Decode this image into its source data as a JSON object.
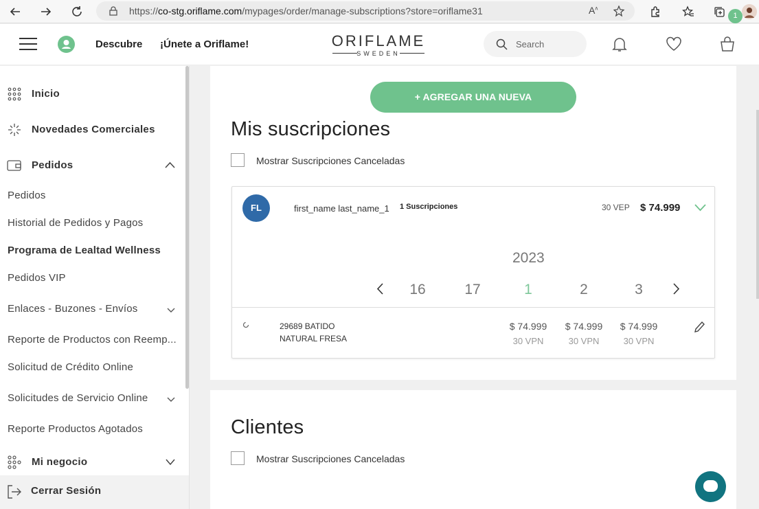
{
  "browser": {
    "url_prefix": "https://",
    "url_domain": "co-stg.oriflame.com",
    "url_path": "/mypages/order/manage-subscriptions?store=oriflame31"
  },
  "header": {
    "nav_discover": "Descubre",
    "nav_join": "¡Únete a Oriflame!",
    "logo_main": "ORIFLAME",
    "logo_sub": "SWEDEN",
    "search_placeholder": "Search",
    "cart_count": "1"
  },
  "sidebar": {
    "inicio": "Inicio",
    "novedades": "Novedades Comerciales",
    "pedidos": "Pedidos",
    "sub": {
      "pedidos": "Pedidos",
      "historial": "Historial de Pedidos y Pagos",
      "lealtad": "Programa de Lealtad Wellness",
      "vip": "Pedidos VIP",
      "enlaces": "Enlaces - Buzones - Envíos",
      "reporte_reemp": "Reporte de Productos con Reemp...",
      "credito": "Solicitud de Crédito Online",
      "servicio": "Solicitudes de Servicio Online",
      "agotados": "Reporte Productos Agotados"
    },
    "negocio": "Mi negocio",
    "logout": "Cerrar Sesión"
  },
  "main": {
    "add_button": "+ AGREGAR UNA NUEVA",
    "title": "Mis suscripciones",
    "show_cancelled": "Mostrar Suscripciones Canceladas",
    "subscriber": {
      "initials": "FL",
      "name": "first_name last_name_1",
      "count": "1 Suscripciones",
      "vep": "30 VEP",
      "total": "$ 74.999"
    },
    "calendar": {
      "year": "2023",
      "periods": [
        "16",
        "17",
        "1",
        "2",
        "3"
      ],
      "active_index": 2
    },
    "product": {
      "line1": "29689 BATIDO",
      "line2": "NATURAL FRESA",
      "prices": [
        "$ 74.999",
        "$ 74.999",
        "$ 74.999"
      ],
      "vpns": [
        "30 VPN",
        "30 VPN",
        "30 VPN"
      ]
    },
    "clients_title": "Clientes",
    "clients_show_cancelled": "Mostrar Suscripciones Canceladas"
  },
  "colors": {
    "brand_green": "#6fc28d",
    "avatar_blue": "#2f6aa8",
    "chat_teal": "#117480"
  }
}
